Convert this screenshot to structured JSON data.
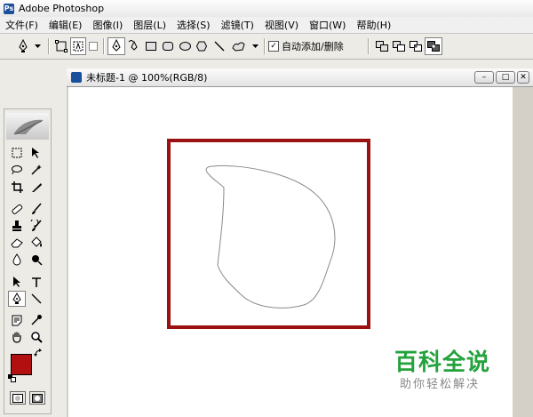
{
  "app": {
    "title": "Adobe Photoshop"
  },
  "menu": {
    "items": [
      "文件(F)",
      "编辑(E)",
      "图像(I)",
      "图层(L)",
      "选择(S)",
      "滤镜(T)",
      "视图(V)",
      "窗口(W)",
      "帮助(H)"
    ]
  },
  "options": {
    "auto_add_delete_label": "自动添加/删除",
    "auto_add_delete_checked": "✓"
  },
  "document": {
    "title": "未标题-1 @ 100%(RGB/8)",
    "min_glyph": "–",
    "max_glyph": "□",
    "close_glyph": "✕"
  },
  "toolbox": {
    "foreground_color": "#b20f10",
    "background_color": "#ffffff"
  },
  "annotation": {
    "color": "#9b1111"
  },
  "watermark": {
    "main": "百科全说",
    "sub": "助你轻松解决",
    "color": "#24a23c"
  }
}
